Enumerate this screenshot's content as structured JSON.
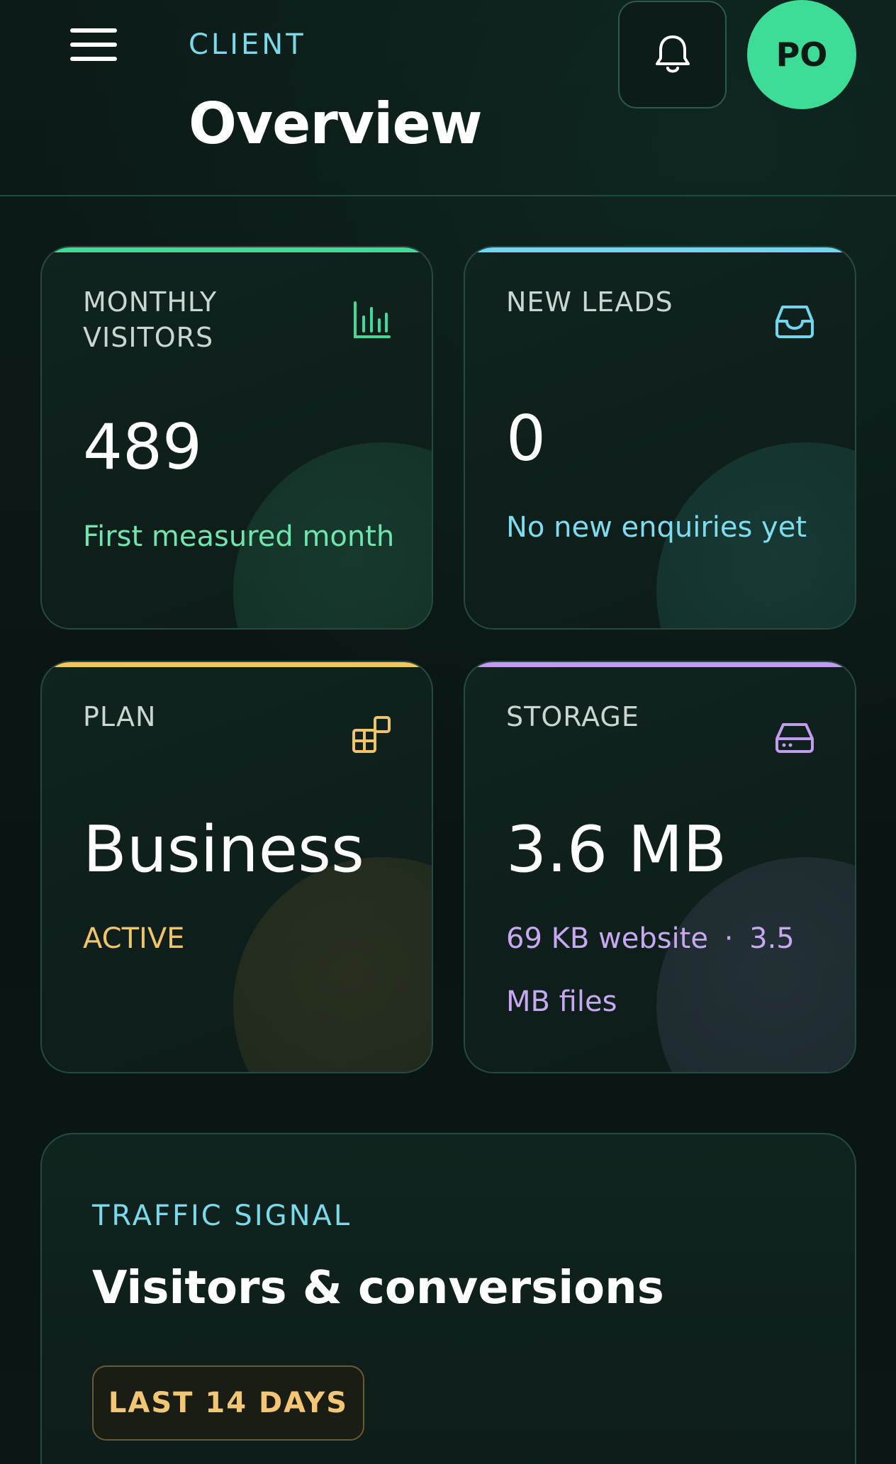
{
  "header": {
    "eyebrow": "CLIENT",
    "title": "Overview",
    "avatar_initials": "PO",
    "menu_icon": "hamburger-icon",
    "bell_icon": "bell-icon"
  },
  "colors": {
    "accent_green": "#3fdc98",
    "accent_cyan": "#6fd8f0",
    "accent_gold": "#f2c46a",
    "accent_purple": "#c29cf0"
  },
  "cards": {
    "visitors": {
      "label": "MONTHLY VISITORS",
      "value": "489",
      "sub": "First measured month",
      "icon": "bar-chart-icon"
    },
    "leads": {
      "label": "NEW LEADS",
      "value": "0",
      "sub": "No new enquiries yet",
      "icon": "inbox-icon"
    },
    "plan": {
      "label": "PLAN",
      "value": "Business",
      "sub": "ACTIVE",
      "icon": "blocks-icon"
    },
    "storage": {
      "label": "STORAGE",
      "value": "3.6 MB",
      "sub_website": "69 KB website",
      "separator": "·",
      "sub_files_a": "3.5",
      "sub_files_b": "MB files",
      "icon": "hard-drive-icon"
    }
  },
  "traffic": {
    "eyebrow": "TRAFFIC SIGNAL",
    "title": "Visitors & conversions",
    "range_label": "LAST 14 DAYS"
  }
}
